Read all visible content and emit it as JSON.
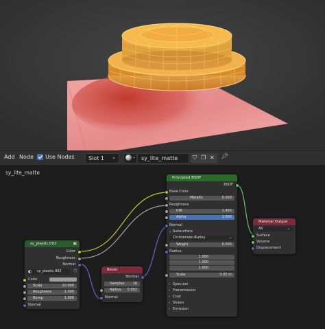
{
  "header": {
    "menu_add": "Add",
    "menu_node": "Node",
    "use_nodes_label": "Use Nodes",
    "slot_value": "Slot 1",
    "material_name": "sy_lite_matte"
  },
  "editor": {
    "breadcrumb": "sy_lite_matte"
  },
  "nodes": {
    "bsdf": {
      "title": "Principled BSDF",
      "output_bsdf": "BSDF",
      "base_color": "Base Color",
      "metallic_label": "Metallic",
      "metallic_value": "0.000",
      "roughness": "Roughness",
      "ior_label": "IOR",
      "ior_value": "1.450",
      "alpha_label": "Alpha",
      "alpha_value": "1.000",
      "normal": "Normal",
      "subsurface": "Subsurface",
      "method": "Christensen-Burley",
      "weight_label": "Weight",
      "weight_value": "0.000",
      "radius": "Radius:",
      "radius_1": "1.000",
      "radius_2": "1.000",
      "radius_3": "1.000",
      "scale_label": "Scale",
      "scale_value": "0.05 m",
      "specular": "Specular",
      "transmission": "Transmission",
      "coat": "Coat",
      "sheen": "Sheen",
      "emission": "Emission"
    },
    "output": {
      "title": "Material Output",
      "target": "All",
      "surface": "Surface",
      "volume": "Volume",
      "displacement": "Displacement"
    },
    "plastic": {
      "title": "sy_plastic.002",
      "out_color": "Color",
      "out_roughness": "Roughness",
      "out_normal": "Normal",
      "group_name": "sy_plastic.002",
      "in_color": "Color",
      "scale_label": "Scale",
      "scale_value": "10.000",
      "roughness_label": "Roughness",
      "roughness_value": "1.000",
      "bump_label": "Bump",
      "bump_value": "1.000",
      "in_normal": "Normal"
    },
    "bevel": {
      "title": "Bevel",
      "out_normal": "Normal",
      "samples_label": "Samples",
      "samples_value": "16",
      "radius_label": "Radius",
      "radius_value": "0.002",
      "in_normal": "Normal"
    }
  },
  "colors": {
    "bsdf_header": "#2c6a2c",
    "output_header": "#7a2b3b",
    "plastic_header": "#2c5a2c",
    "bevel_header": "#7a2b3b",
    "alpha_field": "#4772b3",
    "wire": "#d98a1a",
    "model_fill": "#e89b2a"
  }
}
